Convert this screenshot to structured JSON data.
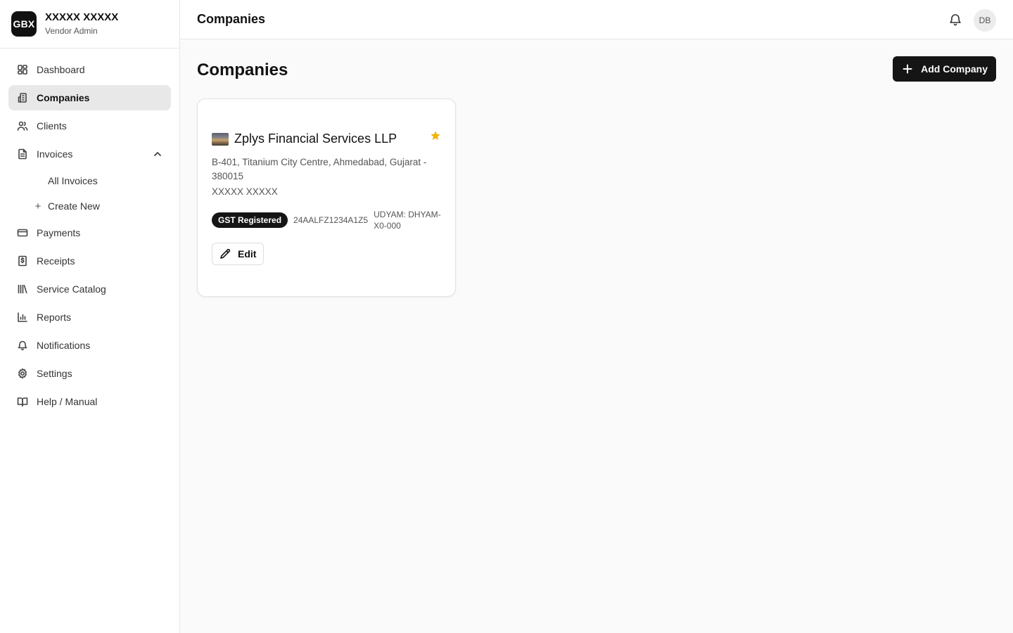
{
  "brand": {
    "logo_text": "GBX",
    "name": "XXXXX XXXXX",
    "role": "Vendor Admin"
  },
  "sidebar": {
    "items": [
      {
        "label": "Dashboard",
        "icon": "dashboard-icon"
      },
      {
        "label": "Companies",
        "icon": "building-icon",
        "active": true
      },
      {
        "label": "Clients",
        "icon": "users-icon"
      },
      {
        "label": "Invoices",
        "icon": "file-icon",
        "expanded": true
      },
      {
        "label": "Payments",
        "icon": "credit-card-icon"
      },
      {
        "label": "Receipts",
        "icon": "receipt-icon"
      },
      {
        "label": "Service Catalog",
        "icon": "library-icon"
      },
      {
        "label": "Reports",
        "icon": "bar-chart-icon"
      },
      {
        "label": "Notifications",
        "icon": "bell-icon"
      },
      {
        "label": "Settings",
        "icon": "gear-icon"
      },
      {
        "label": "Help / Manual",
        "icon": "book-icon"
      }
    ],
    "invoice_sub": {
      "all": "All Invoices",
      "create": "Create New"
    }
  },
  "topbar": {
    "title": "Companies",
    "avatar_initials": "DB"
  },
  "main": {
    "title": "Companies",
    "add_button": "Add Company",
    "companies": [
      {
        "name": "Zplys Financial Services LLP",
        "address": "B-401, Titanium City Centre, Ahmedabad, Gujarat - 380015",
        "owner": "XXXXX XXXXX",
        "gst_badge": "GST Registered",
        "gstin": "24AALFZ1234A1Z5",
        "udyam": "UDYAM: DHYAM-X0-000",
        "edit_label": "Edit",
        "favorite": true
      }
    ]
  },
  "colors": {
    "accent": "#151515",
    "active_nav": "#e8e8e8",
    "star": "#f0b400"
  }
}
